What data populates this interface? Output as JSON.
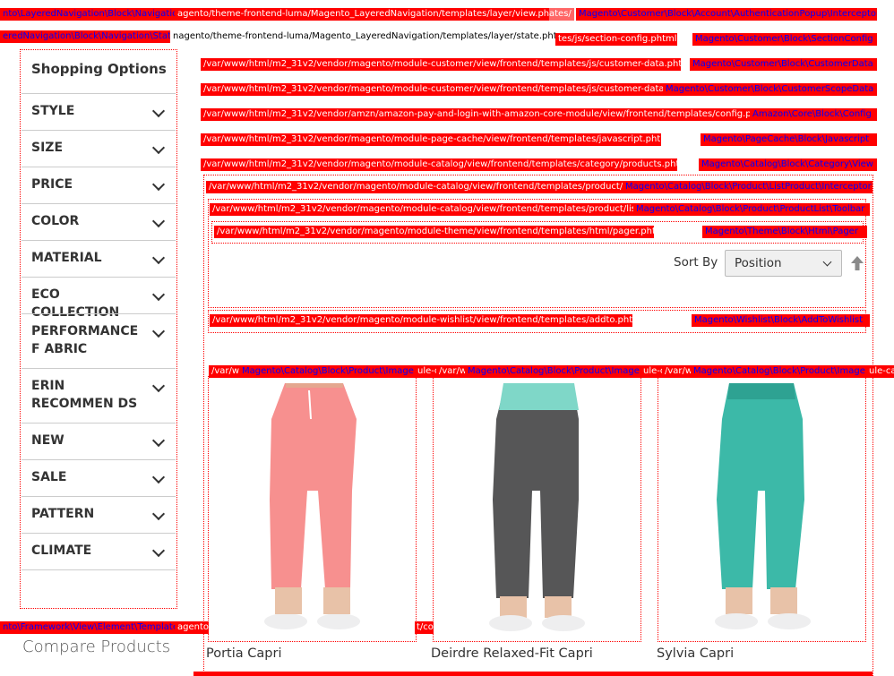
{
  "hints": {
    "layered_nav_block": "nto\\LayeredNavigation\\Block\\Navigation",
    "layer_view_tpl": "agento/theme-frontend-luma/Magento_LayeredNavigation/templates/layer/view.phtml",
    "view_overlap": "ates/",
    "auth_popup_block": "Magento\\Customer\\Block\\Account\\AuthenticationPopup\\Interceptor",
    "layered_state_block": "eredNavigation\\Block\\Navigation\\State",
    "layer_state_tpl": "nagento/theme-frontend-luma/Magento_LayeredNavigation/templates/layer/state.phtml",
    "section_config_tpl": "tes/js/section-config.phtml",
    "section_config_block": "Magento\\Customer\\Block\\SectionConfig",
    "customer_data_tpl": "/var/www/html/m2_31v2/vendor/magento/module-customer/view/frontend/templates/js/customer-data.phtml",
    "customer_data_block": "Magento\\Customer\\Block\\CustomerData",
    "customer_inv_tpl": "/var/www/html/m2_31v2/vendor/magento/module-customer/view/frontend/templates/js/customer-data/inva",
    "customer_scope_block": "Magento\\Customer\\Block\\CustomerScopeData",
    "amazon_tpl": "/var/www/html/m2_31v2/vendor/amzn/amazon-pay-and-login-with-amazon-core-module/view/frontend/templates/config.phtm",
    "amazon_block": "Amazon\\Core\\Block\\Config",
    "page_cache_tpl": "/var/www/html/m2_31v2/vendor/magento/module-page-cache/view/frontend/templates/javascript.phtml",
    "page_cache_block": "Magento\\PageCache\\Block\\Javascript",
    "products_tpl": "/var/www/html/m2_31v2/vendor/magento/module-catalog/view/frontend/templates/category/products.phtml",
    "category_view_block": "Magento\\Catalog\\Block\\Category\\View",
    "list_tpl": "/var/www/html/m2_31v2/vendor/magento/module-catalog/view/frontend/templates/product/list.p",
    "list_block": "Magento\\Catalog\\Block\\Product\\ListProduct\\Interceptor",
    "toolbar_tpl": "/var/www/html/m2_31v2/vendor/magento/module-catalog/view/frontend/templates/product/list/to",
    "toolbar_block": "Magento\\Catalog\\Block\\Product\\ProductList\\Toolbar",
    "pager_tpl": "/var/www/html/m2_31v2/vendor/magento/module-theme/view/frontend/templates/html/pager.phtml",
    "pager_block": "Magento\\Theme\\Block\\Html\\Pager",
    "addto_tpl": "/var/www/html/m2_31v2/vendor/magento/module-wishlist/view/frontend/templates/addto.phtml",
    "wishlist_block": "Magento\\Wishlist\\Block\\AddToWishlist",
    "img1_prefix": "/var/w",
    "image_block": "Magento\\Catalog\\Block\\Product\\Image",
    "img1_suffix": "ule-c",
    "img2_prefix": "/var/w",
    "img2_suffix": "ule-c",
    "img3_prefix": "/var/w",
    "img3_suffix": "ule-cat",
    "framework_block": "nto\\Framework\\View\\Element\\Template",
    "framework_tpl": "agento/r",
    "framework_tail": "t/com"
  },
  "sidebar": {
    "title": "Shopping Options",
    "filters": [
      {
        "label": "STYLE",
        "name": "filter-style"
      },
      {
        "label": "SIZE",
        "name": "filter-size"
      },
      {
        "label": "PRICE",
        "name": "filter-price"
      },
      {
        "label": "COLOR",
        "name": "filter-color"
      },
      {
        "label": "MATERIAL",
        "name": "filter-material"
      },
      {
        "label": "ECO COLLECTION",
        "name": "filter-eco-collection"
      },
      {
        "label": "PERFORMANCE F ABRIC",
        "name": "filter-performance-fabric"
      },
      {
        "label": "ERIN RECOMMEN DS",
        "name": "filter-erin-recommends"
      },
      {
        "label": "NEW",
        "name": "filter-new"
      },
      {
        "label": "SALE",
        "name": "filter-sale"
      },
      {
        "label": "PATTERN",
        "name": "filter-pattern"
      },
      {
        "label": "CLIMATE",
        "name": "filter-climate"
      }
    ]
  },
  "compare": {
    "title": "Compare Products"
  },
  "toolbar": {
    "sort_label": "Sort By",
    "sort_value": "Position",
    "sort_direction_icon": "arrow-up-icon"
  },
  "products": [
    {
      "name": "Portia Capri",
      "color": "pink"
    },
    {
      "name": "Deirdre Relaxed-Fit Capri",
      "color": "gray-teal"
    },
    {
      "name": "Sylvia Capri",
      "color": "teal"
    }
  ],
  "colors": {
    "hint_bg": "#ff0000",
    "hint_text": "#ffffff",
    "hint_class_text": "#0000ff",
    "border": "#cccccc"
  }
}
